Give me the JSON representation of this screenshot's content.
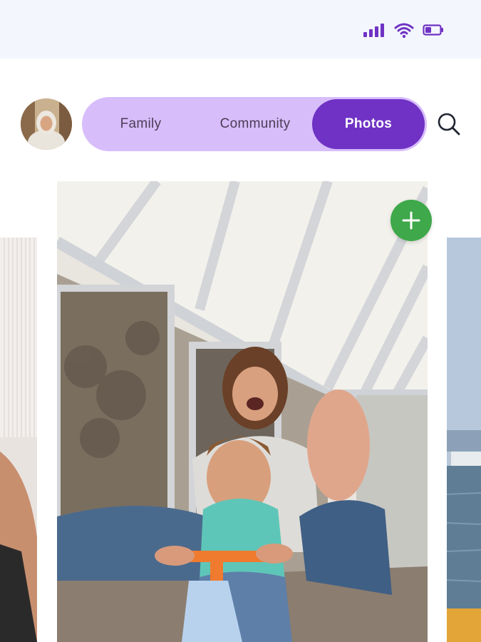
{
  "status_bar": {
    "icons": [
      "signal-icon",
      "wifi-icon",
      "battery-icon"
    ],
    "icon_color": "#6f32c4"
  },
  "header": {
    "tabs": [
      {
        "label": "Family",
        "active": false
      },
      {
        "label": "Community",
        "active": false
      },
      {
        "label": "Photos",
        "active": true
      }
    ],
    "tab_bar_color": "#d8bdfb",
    "active_tab_color": "#6f32c4",
    "search_icon": "search-icon"
  },
  "carousel": {
    "add_button_icon": "plus-icon",
    "add_button_color": "#3ea84a"
  }
}
